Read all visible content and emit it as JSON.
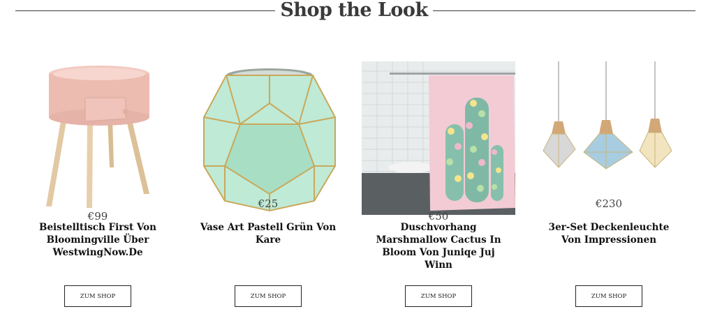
{
  "section": {
    "title": "Shop the Look"
  },
  "products": [
    {
      "name": "Beistelltisch First Von Bloomingville Über WestwingNow.De",
      "price": "€99",
      "button": "ZUM SHOP"
    },
    {
      "name": "Vase Art Pastell Grün Von Kare",
      "price": "€25",
      "button": "ZUM SHOP"
    },
    {
      "name": "Duschvorhang Marshmallow Cactus In Bloom Von Juniqe Juj Winn",
      "price": "€50",
      "button": "ZUM SHOP"
    },
    {
      "name": "3er-Set Deckenleuchte Von Impressionen",
      "price": "€230",
      "button": "ZUM SHOP"
    }
  ]
}
